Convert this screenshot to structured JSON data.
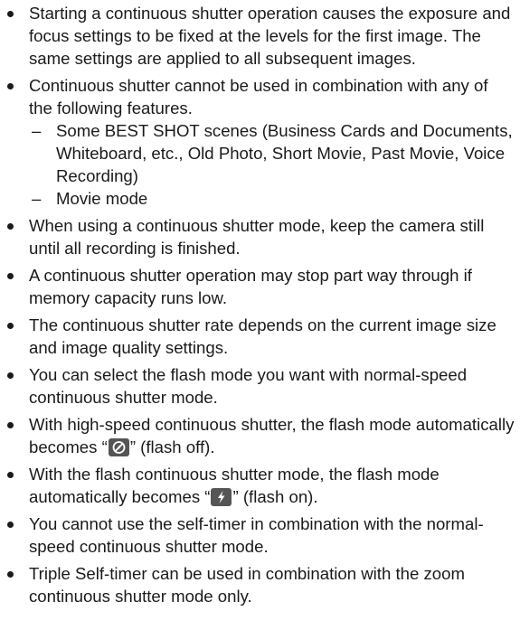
{
  "notes": [
    {
      "text": "Starting a continuous shutter operation causes the exposure and focus settings to be fixed at the levels for the first image. The same settings are applied to all subsequent images."
    },
    {
      "text": "Continuous shutter cannot be used in combination with any of the following features.",
      "subitems": [
        "Some BEST SHOT scenes (Business Cards and Documents, Whiteboard, etc., Old Photo, Short Movie, Past Movie, Voice Recording)",
        "Movie mode"
      ]
    },
    {
      "text": "When using a continuous shutter mode, keep the camera still until all recording is finished."
    },
    {
      "text": "A continuous shutter operation may stop part way through if memory capacity runs low."
    },
    {
      "text": "The continuous shutter rate depends on the current image size and image quality settings."
    },
    {
      "text": "You can select the flash mode you want with normal-speed continuous shutter mode."
    },
    {
      "before": "With high-speed continuous shutter, the flash mode automatically becomes “",
      "icon": "flash-off-icon",
      "after": "” (flash off)."
    },
    {
      "before": "With the flash continuous shutter mode, the flash mode automatically becomes “",
      "icon": "flash-on-icon",
      "after": "” (flash on)."
    },
    {
      "text": "You cannot use the self-timer in combination with the normal-speed continuous shutter mode."
    },
    {
      "text": "Triple Self-timer can be used in combination with the zoom continuous shutter mode only."
    }
  ],
  "dash_glyph": "–",
  "icon_colors": {
    "box": "#555555",
    "glyph": "#ffffff"
  }
}
